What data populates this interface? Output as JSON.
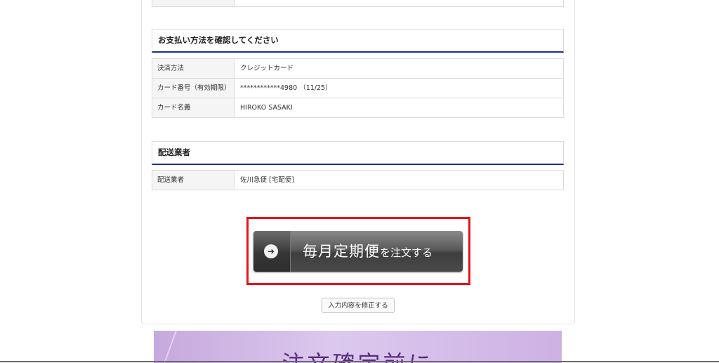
{
  "payment": {
    "heading": "お支払い方法を確認してください",
    "rows": [
      {
        "label": "決済方法",
        "value": "クレジットカード"
      },
      {
        "label": "カード番号（有効期限）",
        "value": "************4980 （11/25）"
      },
      {
        "label": "カード名義",
        "value": "HIROKO SASAKI"
      }
    ]
  },
  "delivery": {
    "heading": "配送業者",
    "rows": [
      {
        "label": "配送業者",
        "value": "佐川急便 [宅配便]"
      }
    ]
  },
  "order_button": {
    "label_main": "毎月定期便",
    "label_sub": "を注文する",
    "icon": "arrow-right-circle-icon"
  },
  "edit_button": {
    "label": "入力内容を修正する"
  },
  "banner": {
    "title": "注文確定前に"
  },
  "colors": {
    "section_underline": "#1f2f8c",
    "highlight_border": "#e8131b"
  }
}
